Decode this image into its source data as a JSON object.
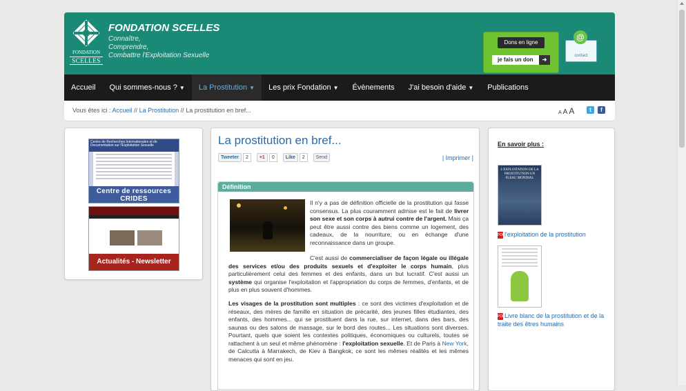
{
  "header": {
    "logo_line1": "FONDATION",
    "logo_line2": "SCELLES",
    "title": "FONDATION SCELLES",
    "tagline": [
      "Connaître,",
      "Comprendre,",
      "Combattre l'Exploitation Sexuelle"
    ],
    "don_label": "Dons en ligne",
    "don_button": "je fais un don",
    "contact_label": "contact"
  },
  "nav": {
    "items": [
      {
        "label": "Accueil",
        "dropdown": false
      },
      {
        "label": "Qui sommes-nous ?",
        "dropdown": true
      },
      {
        "label": "La Prostitution",
        "dropdown": true,
        "active": true
      },
      {
        "label": "Les prix Fondation",
        "dropdown": true
      },
      {
        "label": "Évènements",
        "dropdown": false
      },
      {
        "label": "J'ai besoin d'aide",
        "dropdown": true
      },
      {
        "label": "Publications",
        "dropdown": false
      }
    ]
  },
  "breadcrumb": {
    "prefix": "Vous êtes ici :",
    "home": "Accueil",
    "section": "La Prostitution",
    "current": "La prostitution en bref...",
    "sep": "//"
  },
  "fontsize": {
    "small": "A",
    "medium": "A",
    "large": "A"
  },
  "left": {
    "crides_header": "Centre de Recherches Internationales et de Documentation sur l'Exploitation Sexuelle",
    "crides_caption": "Centre de ressources CRIDES",
    "news_caption": "Actualités - Newsletter"
  },
  "article": {
    "title": "La prostitution en bref...",
    "share": {
      "tweet": "Tweeter",
      "tweet_count": "2",
      "gplus": "+1",
      "gplus_count": "0",
      "like": "Like",
      "like_count": "2",
      "send": "Send"
    },
    "print": "| Imprimer |",
    "section_title": "Définition",
    "p1_a": "Il n'y a pas de définition officielle de la prostitution qui fasse consensus. La plus couramment admise est le fait de ",
    "p1_b": "livrer son sexe et son corps à autrui contre de l'argent.",
    "p1_c": " Mais ça peut être aussi contre des biens comme un logement, des cadeaux, de la nourriture, ou en échange d'une reconnaissance dans un groupe.",
    "p2_a": "C'est aussi de ",
    "p2_b": "commercialiser de façon légale ou illégale des services et/ou des produits sexuels et d'exploiter le corps humain",
    "p2_c": ", plus particulièrement celui des femmes et des enfants, dans un but lucratif. C'est aussi un ",
    "p2_d": "système",
    "p2_e": " qui organise l'exploitation et l'appropriation du corps de femmes, d'enfants, et de plus en plus souvent d'hommes.",
    "p3_a": "Les visages de la prostitution sont multiples",
    "p3_b": " : ce sont des victimes d'exploitation et de réseaux, des mères de famille en situation de précarité, des jeunes filles étudiantes, des enfants, des hommes... qui se prostituent dans la rue, sur internet, dans des bars, des saunas ou des salons de massage, sur le bord des routes... Les situations sont diverses. Pourtant, quels que soient les contextes politiques, économiques ou culturels, toutes se rattachent à un seul et même phénomène : ",
    "p3_c": "l'exploitation sexuelle",
    "p3_d": ". Et de Paris à ",
    "p3_link": "New York",
    "p3_e": ", de Calcutta à Marrakech, de Kiev à Bangkok, ce sont les mêmes réalités et les mêmes menaces qui sont en jeu."
  },
  "right": {
    "title": "En savoir plus :",
    "book1_cover": "L'EXPLOITATION DE LA PROSTITUTION UN FLEAU MONDIAL",
    "link1": "l'exploitation de la prostitution",
    "link2": "Livre blanc de la prostitution et de la traite des êtres humains"
  },
  "colors": {
    "header_bg": "#1a8a76",
    "nav_bg": "#1b1b1b",
    "link": "#2a6aa8",
    "section_header": "#5cad9b"
  }
}
